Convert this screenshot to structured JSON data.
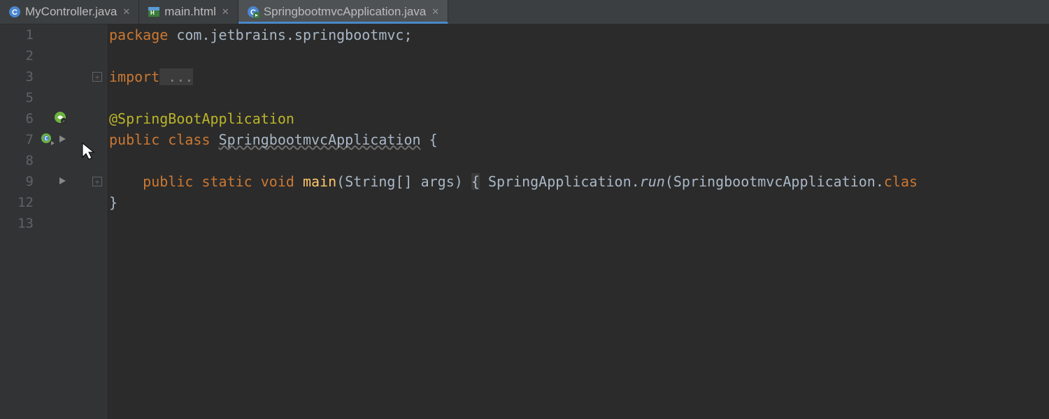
{
  "tabs": [
    {
      "label": "MyController.java",
      "icon": "java-class"
    },
    {
      "label": "main.html",
      "icon": "html"
    },
    {
      "label": "SpringbootmvcApplication.java",
      "icon": "java-run"
    }
  ],
  "activeTab": 2,
  "gutter": {
    "lines": [
      "1",
      "2",
      "3",
      "5",
      "6",
      "7",
      "8",
      "9",
      "12",
      "13"
    ]
  },
  "code": {
    "l1_kw": "package",
    "l1_pkg": " com.jetbrains.springbootmvc",
    "l1_sc": ";",
    "l3_kw": "import",
    "l3_fold": " ...",
    "l6_annot": "@SpringBootApplication",
    "l7_pub": "public",
    "l7_sp1": " ",
    "l7_class": "class",
    "l7_sp2": " ",
    "l7_name": "SpringbootmvcApplication",
    "l7_brace": " {",
    "l9_indent": "    ",
    "l9_pub": "public",
    "l9_sp1": " ",
    "l9_static": "static",
    "l9_sp2": " ",
    "l9_void": "void",
    "l9_sp3": " ",
    "l9_main": "main",
    "l9_paren1": "(",
    "l9_argtype": "String[] args",
    "l9_paren2": ")",
    "l9_sp4": " ",
    "l9_obr": "{",
    "l9_sp5": " ",
    "l9_call1": "SpringApplication.",
    "l9_run": "run",
    "l9_paren3": "(",
    "l9_arg2": "SpringbootmvcApplication.",
    "l9_clas": "clas",
    "l12_cbr": "}"
  }
}
